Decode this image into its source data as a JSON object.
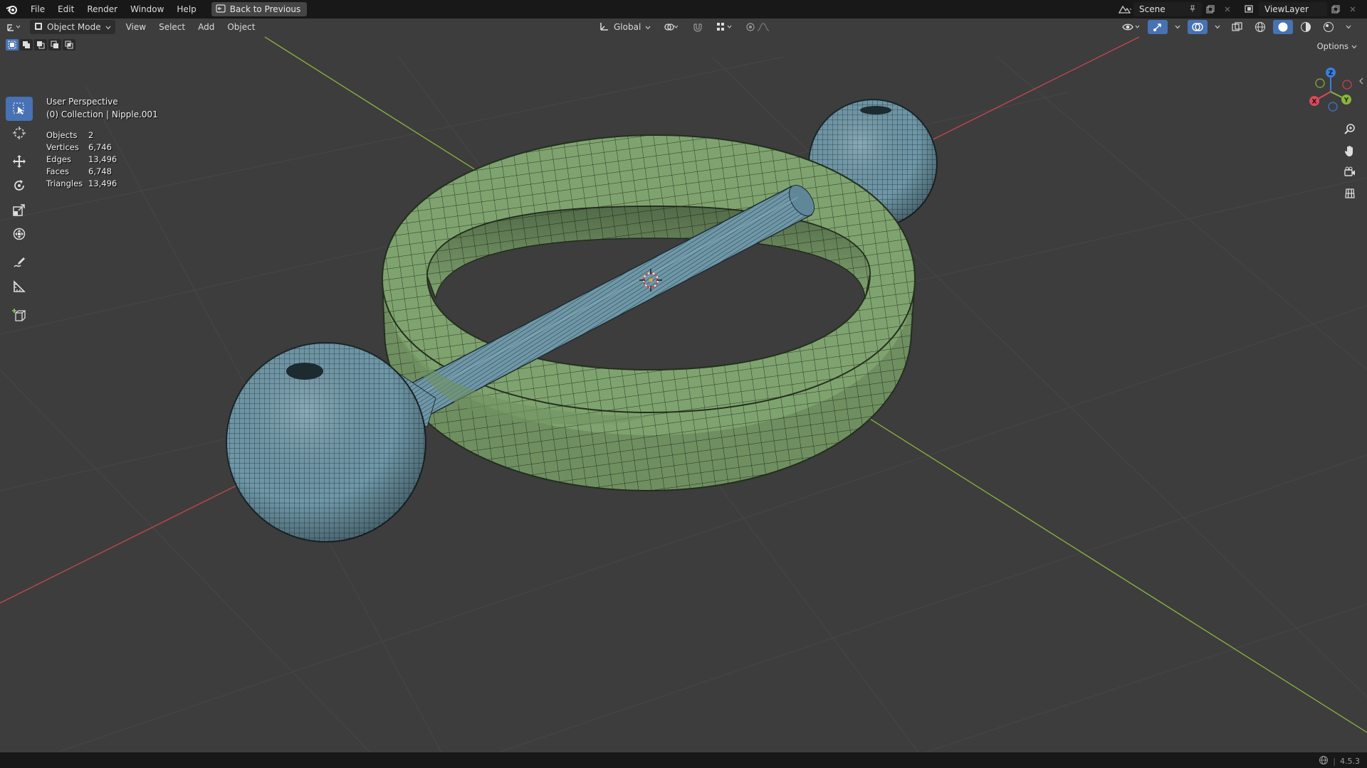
{
  "topbar": {
    "menus": [
      "File",
      "Edit",
      "Render",
      "Window",
      "Help"
    ],
    "back_button": "Back to Previous",
    "scene_name": "Scene",
    "view_layer": "ViewLayer"
  },
  "viewport_header": {
    "mode": "Object Mode",
    "menus": [
      "View",
      "Select",
      "Add",
      "Object"
    ],
    "orientation": "Global",
    "options_label": "Options"
  },
  "overlay": {
    "view_name": "User Perspective",
    "collection": "(0) Collection | Nipple.001"
  },
  "stats": [
    {
      "label": "Objects",
      "value": "2"
    },
    {
      "label": "Vertices",
      "value": "6,746"
    },
    {
      "label": "Edges",
      "value": "13,496"
    },
    {
      "label": "Faces",
      "value": "6,748"
    },
    {
      "label": "Triangles",
      "value": "13,496"
    }
  ],
  "gizmo": {
    "x": "X",
    "y": "Y",
    "z": "Z"
  },
  "statusbar": {
    "version": "4.5.3"
  },
  "colors": {
    "ring": "#7fa36f",
    "metal": "#6f98a8",
    "x_axis": "#c8464e",
    "y_axis": "#8ab63a",
    "selected": "#4772b3"
  }
}
